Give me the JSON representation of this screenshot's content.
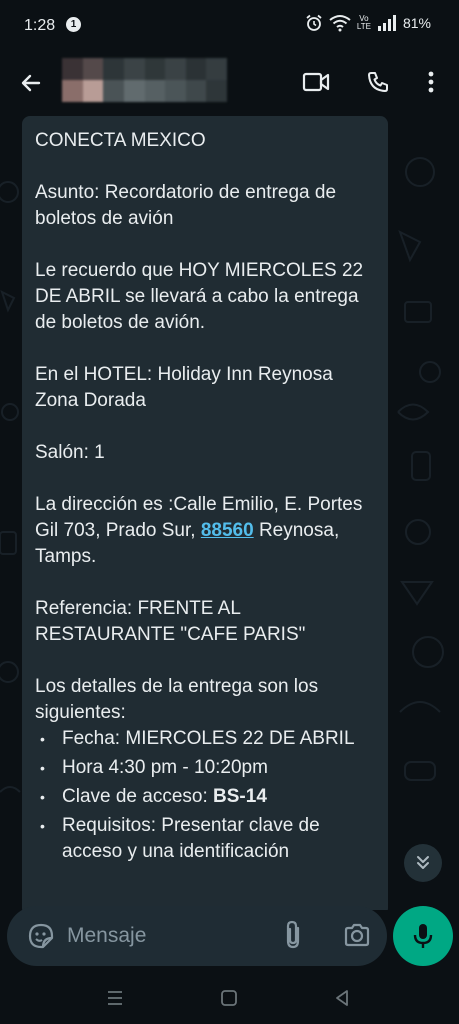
{
  "status_bar": {
    "time": "1:28",
    "notification_count": "1",
    "network_label_top": "Vo",
    "network_label_bottom": "LTE",
    "wifi_label": "6",
    "battery": "81%"
  },
  "header": {
    "back_icon": "arrow-left-icon",
    "video_icon": "video-call-icon",
    "call_icon": "phone-icon",
    "menu_icon": "more-vert-icon"
  },
  "message": {
    "line_company": "CONECTA MEXICO",
    "line_subject": "Asunto: Recordatorio de entrega de boletos de avión",
    "line_reminder": "Le recuerdo que HOY MIERCOLES 22 DE ABRIL se llevará a cabo la entrega de boletos de avión.",
    "line_hotel": "En el HOTEL: Holiday Inn Reynosa Zona Dorada",
    "line_salon": "Salón: 1",
    "address_prefix": "La dirección es :Calle Emilio, E. Portes Gil 703, Prado Sur,",
    "address_zip": "88560",
    "address_suffix": "Reynosa, Tamps.",
    "line_reference": "Referencia: FRENTE AL RESTAURANTE \"CAFE PARIS\"",
    "line_details": "Los detalles de la entrega son los siguientes:",
    "bullet_date": "Fecha: MIERCOLES 22 DE ABRIL",
    "bullet_time": "Hora 4:30 pm - 10:20pm",
    "bullet_code_label": "Clave de acceso:",
    "bullet_code_value": "BS-14",
    "bullet_requirements": "Requisitos: Presentar clave de acceso y una identificación"
  },
  "composer": {
    "placeholder": "Mensaje",
    "sticker_icon": "sticker-icon",
    "attach_icon": "paperclip-icon",
    "camera_icon": "camera-icon",
    "mic_icon": "microphone-icon"
  },
  "nav": {
    "recents_icon": "recents-icon",
    "home_icon": "home-icon",
    "back_icon": "back-triangle-icon"
  },
  "colors": {
    "background": "#0b1014",
    "bubble": "#202c33",
    "accent": "#00a884",
    "link": "#53bdeb",
    "composer": "#1f2c34"
  }
}
